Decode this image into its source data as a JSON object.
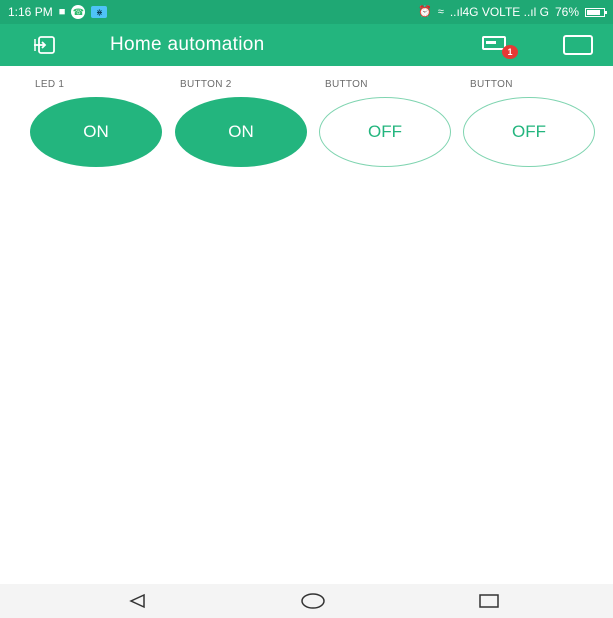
{
  "status_bar": {
    "time": "1:16 PM",
    "network_text": "..ıl4G VOLTE ..ıl G",
    "battery": "76%"
  },
  "app_bar": {
    "title": "Home automation",
    "notification_count": "1"
  },
  "widgets": [
    {
      "label": "LED 1",
      "state": "ON"
    },
    {
      "label": "BUTTON 2",
      "state": "ON"
    },
    {
      "label": "BUTTON",
      "state": "OFF"
    },
    {
      "label": "BUTTON",
      "state": "OFF"
    }
  ],
  "colors": {
    "status_bar": "#1fa874",
    "app_bar": "#23b57e",
    "accent": "#23b57e",
    "badge": "#e53935"
  },
  "icons": {
    "exit": "exit-door-icon",
    "device": "device-tiles-icon",
    "menu": "rectangle-menu-icon",
    "back": "triangle-back-icon",
    "home": "circle-home-icon",
    "recents": "square-recents-icon"
  }
}
